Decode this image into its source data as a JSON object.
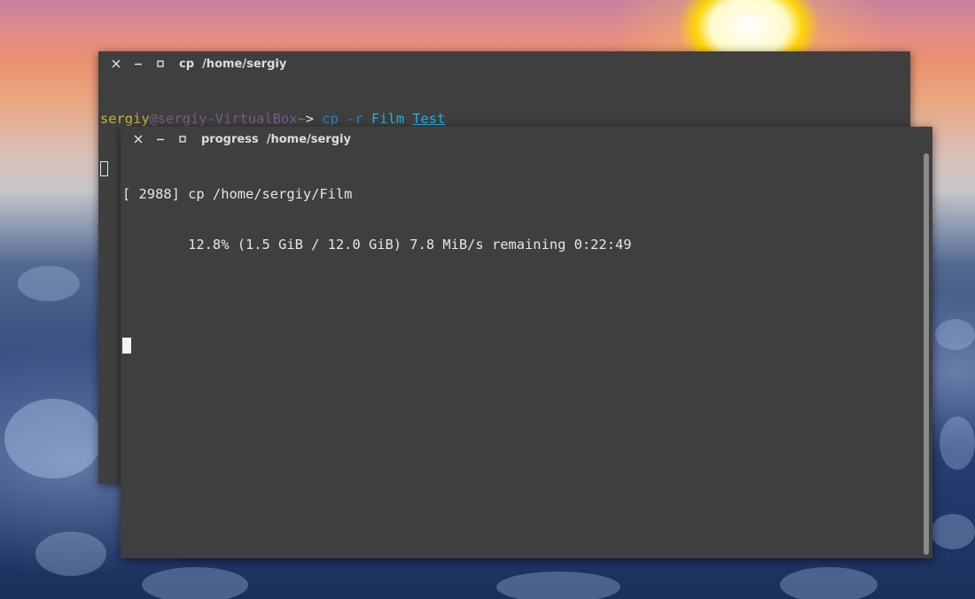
{
  "windows": {
    "back": {
      "title": "cp  /home/sergiy",
      "prompt": {
        "user": "sergiy",
        "at": "@",
        "host": "sergiy-VirtualBox",
        "path": "~",
        "symbol": "> ",
        "command": "cp",
        "flag": "-r",
        "arg1": "Film",
        "arg2": "Test"
      }
    },
    "front": {
      "title": "progress  /home/sergiy",
      "lines": [
        "[ 2988] cp /home/sergiy/Film",
        "        12.8% (1.5 GiB / 12.0 GiB) 7.8 MiB/s remaining 0:22:49"
      ]
    }
  },
  "icons": {
    "close": "close-icon",
    "minimize": "minimize-icon",
    "maximize": "maximize-icon"
  },
  "colors": {
    "terminal_bg": "#3f3f3f",
    "user": "#c7b43a",
    "host": "#7b5c86",
    "path": "#5c9c3b",
    "command": "#2f7ec7",
    "arg": "#26b0e0",
    "text": "#e6e6e6"
  }
}
